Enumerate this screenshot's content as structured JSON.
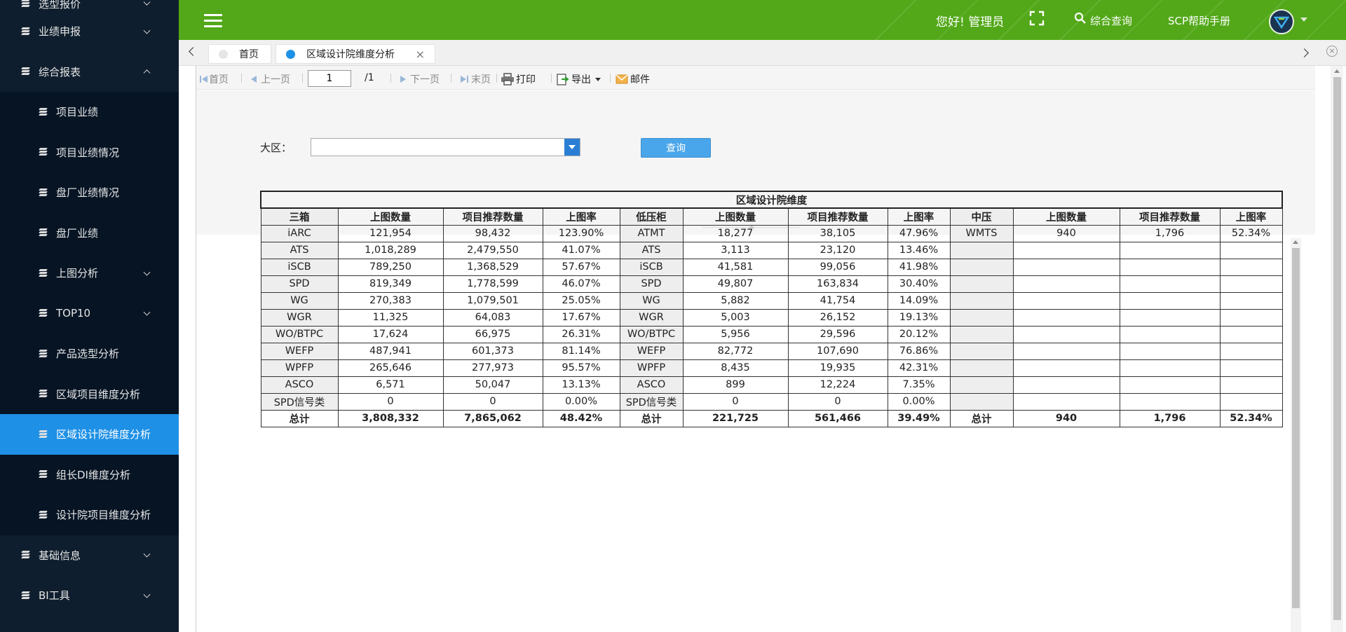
{
  "sidebar": {
    "items": [
      {
        "label": "选型报价",
        "type": "top",
        "chevron": "down"
      },
      {
        "label": "业绩申报",
        "type": "top",
        "chevron": "down"
      },
      {
        "label": "综合报表",
        "type": "top",
        "chevron": "up"
      },
      {
        "label": "项目业绩",
        "type": "sub"
      },
      {
        "label": "项目业绩情况",
        "type": "sub"
      },
      {
        "label": "盘厂业绩情况",
        "type": "sub"
      },
      {
        "label": "盘厂业绩",
        "type": "sub"
      },
      {
        "label": "上图分析",
        "type": "sub",
        "chevron": "down"
      },
      {
        "label": "TOP10",
        "type": "sub",
        "chevron": "down"
      },
      {
        "label": "产品选型分析",
        "type": "sub"
      },
      {
        "label": "区域项目维度分析",
        "type": "sub"
      },
      {
        "label": "区域设计院维度分析",
        "type": "sub",
        "active": true
      },
      {
        "label": "组长DI维度分析",
        "type": "sub"
      },
      {
        "label": "设计院项目维度分析",
        "type": "sub"
      },
      {
        "label": "基础信息",
        "type": "top",
        "chevron": "down"
      },
      {
        "label": "BI工具",
        "type": "top",
        "chevron": "down"
      }
    ]
  },
  "header": {
    "greeting": "您好! 管理员",
    "search_label": "综合查询",
    "help_label": "SCP帮助手册",
    "bg_color": "#52a818"
  },
  "tabs": [
    {
      "label": "首页",
      "dot_color": "#e6e6e6"
    },
    {
      "label": "区域设计院维度分析",
      "dot_color": "#1e90e6",
      "close": "×"
    }
  ],
  "toolbar": {
    "first": "首页",
    "prev": "上一页",
    "page_value": "1",
    "page_total": "/1",
    "next": "下一页",
    "last": "末页",
    "print": "打印",
    "export": "导出",
    "mail": "邮件"
  },
  "filter": {
    "region_label": "大区：",
    "region_value": "",
    "query_button": "查询"
  },
  "report": {
    "title": "区域设计院维度",
    "headers": [
      "三箱",
      "上图数量",
      "项目推荐数量",
      "上图率",
      "低压柜",
      "上图数量",
      "项目推荐数量",
      "上图率",
      "中压",
      "上图数量",
      "项目推荐数量",
      "上图率"
    ],
    "rows": [
      [
        "iARC",
        "121,954",
        "98,432",
        "123.90%",
        "ATMT",
        "18,277",
        "38,105",
        "47.96%",
        "WMTS",
        "940",
        "1,796",
        "52.34%"
      ],
      [
        "ATS",
        "1,018,289",
        "2,479,550",
        "41.07%",
        "ATS",
        "3,113",
        "23,120",
        "13.46%",
        "",
        "",
        "",
        ""
      ],
      [
        "iSCB",
        "789,250",
        "1,368,529",
        "57.67%",
        "iSCB",
        "41,581",
        "99,056",
        "41.98%",
        "",
        "",
        "",
        ""
      ],
      [
        "SPD",
        "819,349",
        "1,778,599",
        "46.07%",
        "SPD",
        "49,807",
        "163,834",
        "30.40%",
        "",
        "",
        "",
        ""
      ],
      [
        "WG",
        "270,383",
        "1,079,501",
        "25.05%",
        "WG",
        "5,882",
        "41,754",
        "14.09%",
        "",
        "",
        "",
        ""
      ],
      [
        "WGR",
        "11,325",
        "64,083",
        "17.67%",
        "WGR",
        "5,003",
        "26,152",
        "19.13%",
        "",
        "",
        "",
        ""
      ],
      [
        "WO/BTPC",
        "17,624",
        "66,975",
        "26.31%",
        "WO/BTPC",
        "5,956",
        "29,596",
        "20.12%",
        "",
        "",
        "",
        ""
      ],
      [
        "WEFP",
        "487,941",
        "601,373",
        "81.14%",
        "WEFP",
        "82,772",
        "107,690",
        "76.86%",
        "",
        "",
        "",
        ""
      ],
      [
        "WPFP",
        "265,646",
        "277,973",
        "95.57%",
        "WPFP",
        "8,435",
        "19,935",
        "42.31%",
        "",
        "",
        "",
        ""
      ],
      [
        "ASCO",
        "6,571",
        "50,047",
        "13.13%",
        "ASCO",
        "899",
        "12,224",
        "7.35%",
        "",
        "",
        "",
        ""
      ],
      [
        "SPD信号类",
        "0",
        "0",
        "0.00%",
        "SPD信号类",
        "0",
        "0",
        "0.00%",
        "",
        "",
        "",
        ""
      ]
    ],
    "totals": [
      "总计",
      "3,808,332",
      "7,865,062",
      "48.42%",
      "总计",
      "221,725",
      "561,466",
      "39.49%",
      "总计",
      "940",
      "1,796",
      "52.34%"
    ]
  }
}
